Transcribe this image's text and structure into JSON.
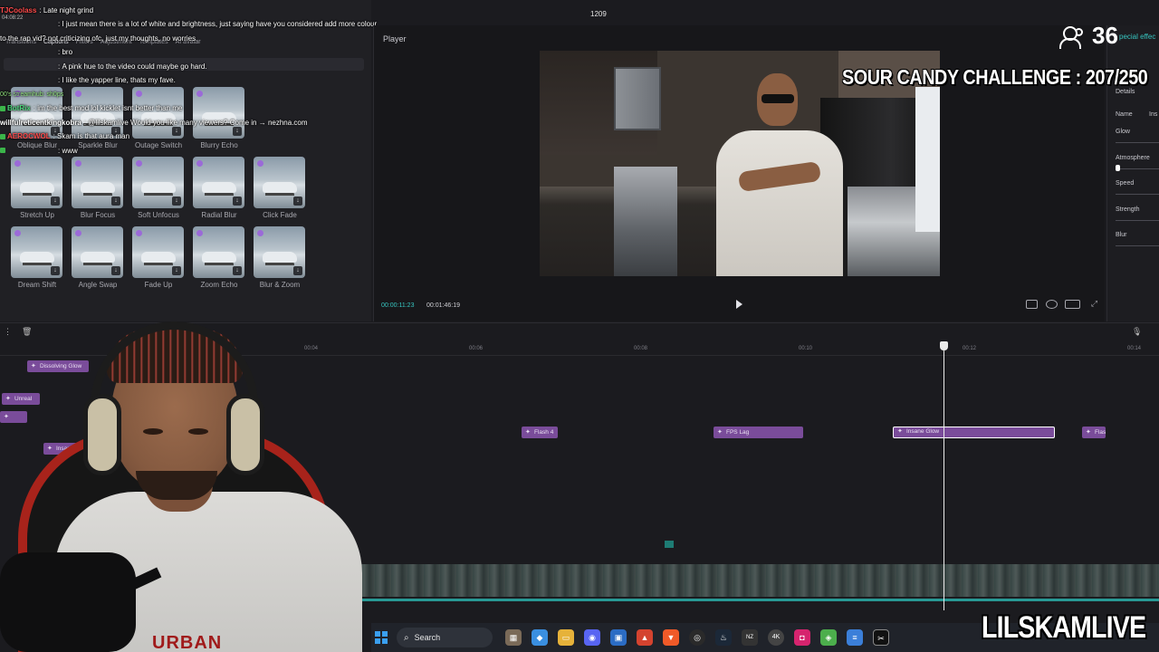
{
  "editor": {
    "tabs": [
      "Transitions",
      "Captions",
      "Filters",
      "Adjustment",
      "Templates",
      "AI avatar"
    ],
    "player_label": "Player",
    "current_time": "00:00:11:23",
    "total_time": "00:01:46:19",
    "frame_counter": "1209",
    "details": {
      "title": "Details",
      "special_effects_tab": "pecial effec",
      "labels": [
        "Name",
        "Glow",
        "Atmosphere",
        "Speed",
        "Strength",
        "Blur"
      ],
      "name_value": "Ins"
    }
  },
  "effects": [
    {
      "label": "Oblique Blur"
    },
    {
      "label": "Sparkle Blur"
    },
    {
      "label": "Outage Switch"
    },
    {
      "label": "Blurry Echo"
    },
    {
      "label": "Stretch Up"
    },
    {
      "label": "Blur Focus"
    },
    {
      "label": "Soft Unfocus"
    },
    {
      "label": "Radial Blur"
    },
    {
      "label": "Click Fade"
    },
    {
      "label": "Dream Shift"
    },
    {
      "label": "Angle Swap"
    },
    {
      "label": "Fade Up"
    },
    {
      "label": "Zoom Echo"
    },
    {
      "label": "Blur & Zoom"
    }
  ],
  "chat": [
    {
      "user": "TJCoolass",
      "text": "Late night grind",
      "color": "#ff4b4b"
    },
    {
      "user": "",
      "text": "I just mean there is a lot of white and brightness, just saying have you considered add more colour",
      "color": "#5aa7ff"
    },
    {
      "user": "",
      "text": "to the rap vid? not criticizing ofc, just my thoughts, no worries",
      "color": "#ffffff"
    },
    {
      "user": "",
      "text": "bro",
      "color": "#ff4b4b"
    },
    {
      "user": "",
      "text": "A pink hue to the video could maybe go hard.",
      "color": "#5aa7ff"
    },
    {
      "user": "",
      "text": "I like the yapper line, thats my fave.",
      "color": "#5aa7ff"
    },
    {
      "user": "BotRix",
      "text": "im the best mod lol kicklet isnt better than me",
      "color": "#4bd37a"
    },
    {
      "user": "willfulreticentkingkobra",
      "text": "@lilskamlive Would you like many viewers? Come in → nezhna.com",
      "color": "#ffffff"
    },
    {
      "user": "AEROCWOL",
      "text": "Skam is that aura man",
      "color": "#ff4b4b"
    },
    {
      "user": "",
      "text": "www",
      "color": "#ff4b4b"
    }
  ],
  "chat_time": "04:08:22",
  "chat_section": "00's streamhub: sh0ps",
  "timeline": {
    "ticks": [
      "00:04",
      "00:06",
      "00:08",
      "00:10",
      "00:12",
      "00:14"
    ],
    "clips": [
      "Dissolving Glow",
      "Unreal",
      "Insane Glow",
      "Flash 4",
      "FPS Lag",
      "Insane Glow",
      "Flas"
    ]
  },
  "overlay": {
    "viewer_count": "36",
    "challenge": "SOUR CANDY CHALLENGE : 207/250",
    "brand": "LILSKAMLIVE",
    "shirt_text": "URBAN"
  },
  "taskbar": {
    "search_label": "Search",
    "icons": [
      "widgets-icon",
      "copilot-icon",
      "folder-icon",
      "discord-icon",
      "store-icon",
      "antivirus-icon",
      "brave-icon",
      "obs-icon",
      "steam-icon",
      "nzxt-icon",
      "4k-icon",
      "instagram-icon",
      "bluestacks-icon",
      "notepad-icon",
      "capcut-icon"
    ]
  },
  "colors": {
    "accent_teal": "#37c6c1",
    "clip_purple": "#7a4c9a",
    "chat_badge": "#3bb54a"
  }
}
